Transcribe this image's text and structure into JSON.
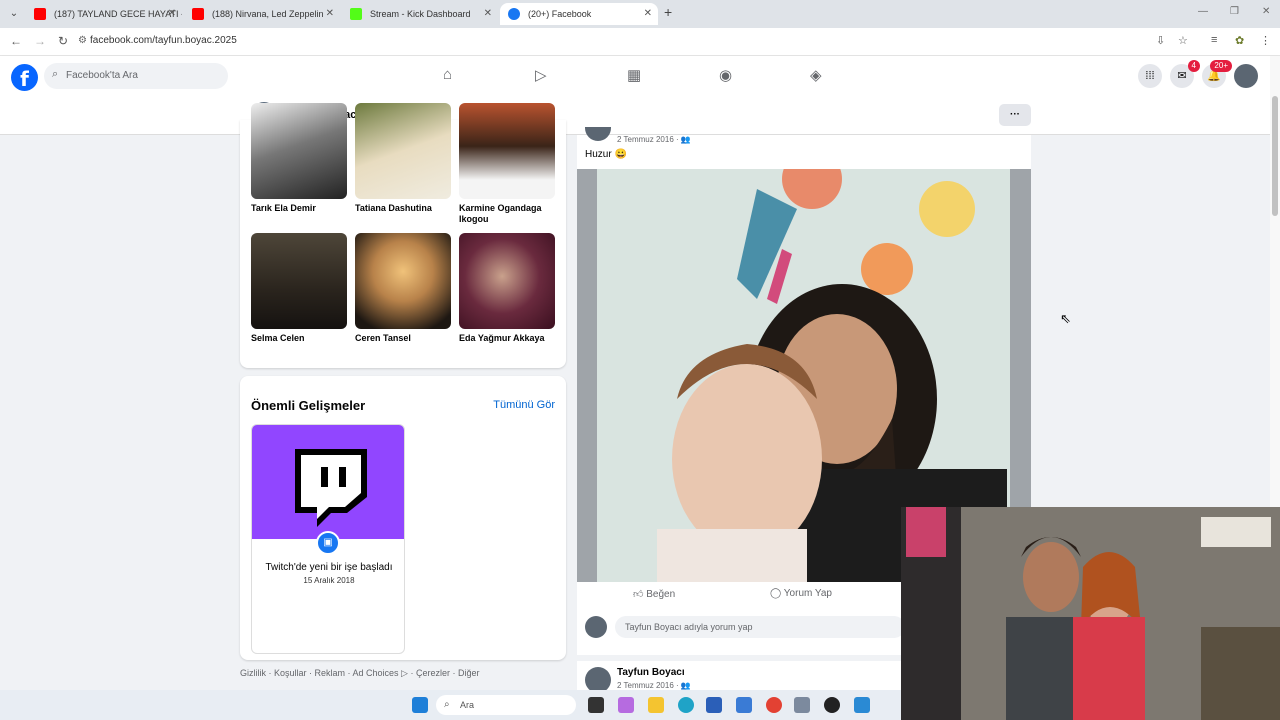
{
  "browser": {
    "tabs": [
      {
        "title": "(187) TAYLAND GECE HAYATI -",
        "color": "#ff0000"
      },
      {
        "title": "(188) Nirvana, Led Zeppelin",
        "color": "#ff0000"
      },
      {
        "title": "Stream - Kick Dashboard",
        "color": "#53fc18"
      },
      {
        "title": "(20+) Facebook",
        "color": "#1877f2"
      }
    ],
    "url": "facebook.com/tayfun.boyac.2025"
  },
  "fb": {
    "search_placeholder": "Facebook'ta Ara",
    "messenger_badge": "4",
    "notif_badge": "20+"
  },
  "profile": {
    "name": "Tayfun Boyacı",
    "more": "···"
  },
  "friends": [
    {
      "name": "Tarık Ela Demir"
    },
    {
      "name": "Tatiana Dashutina"
    },
    {
      "name": "Karmine Ogandaga Ikogou"
    },
    {
      "name": "Selma Celen"
    },
    {
      "name": "Ceren Tansel"
    },
    {
      "name": "Eda Yağmur Akkaya"
    }
  ],
  "highlights": {
    "title": "Önemli Gelişmeler",
    "see_all": "Tümünü Gör",
    "item_text": "Twitch'de yeni bir işe başladı",
    "item_date": "15 Aralık 2018"
  },
  "footer": {
    "links": "Gizlilik · Koşullar · Reklam · Ad Choices ▷ · Çerezler · Diğer"
  },
  "post": {
    "date": "2 Temmuz 2016 · 👥",
    "text": "Huzur 😀",
    "like_label": "Beğen",
    "comment_label": "Yorum Yap",
    "comment_placeholder": "Tayfun Boyacı adıyla yorum yap"
  },
  "post2": {
    "name": "Tayfun Boyacı",
    "date": "2 Temmuz 2016 · 👥"
  },
  "taskbar": {
    "search_placeholder": "Ara"
  }
}
